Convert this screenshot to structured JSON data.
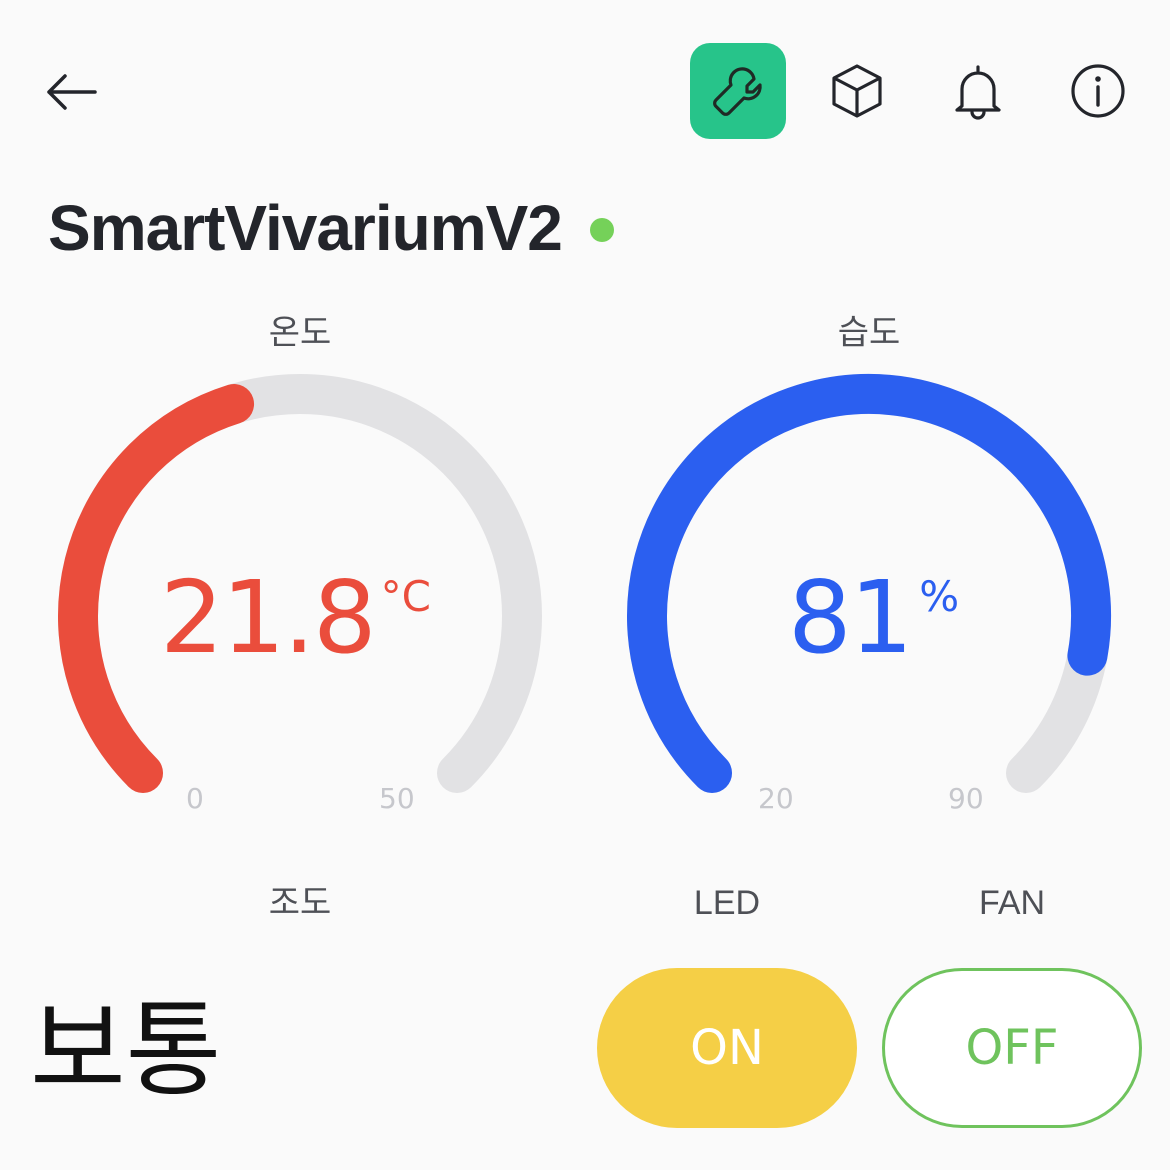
{
  "header": {
    "back_icon": "arrow-left-icon",
    "tools": [
      {
        "icon": "wrench-icon",
        "active": true,
        "color": "#27c48a"
      },
      {
        "icon": "cube-icon",
        "active": false
      },
      {
        "icon": "bell-icon",
        "active": false
      },
      {
        "icon": "info-icon",
        "active": false
      }
    ]
  },
  "device": {
    "name": "SmartVivariumV2",
    "status_color": "#75d159"
  },
  "gauges": [
    {
      "label": "온도",
      "value": "21.8",
      "numeric_value": 21.8,
      "unit": "°C",
      "min": "0",
      "max": "50",
      "min_value": 0,
      "max_value": 50,
      "color": "#ea4d3c",
      "track_color": "#e2e2e4"
    },
    {
      "label": "습도",
      "value": "81",
      "numeric_value": 81,
      "unit": "%",
      "min": "20",
      "max": "90",
      "min_value": 20,
      "max_value": 90,
      "color": "#2b5ff0",
      "track_color": "#e2e2e4"
    }
  ],
  "illuminance": {
    "label": "조도",
    "value": "보통"
  },
  "switches": [
    {
      "label": "LED",
      "state": "ON",
      "on": true,
      "color": "#f5cf46"
    },
    {
      "label": "FAN",
      "state": "OFF",
      "on": false,
      "color": "#6fc35d"
    }
  ]
}
